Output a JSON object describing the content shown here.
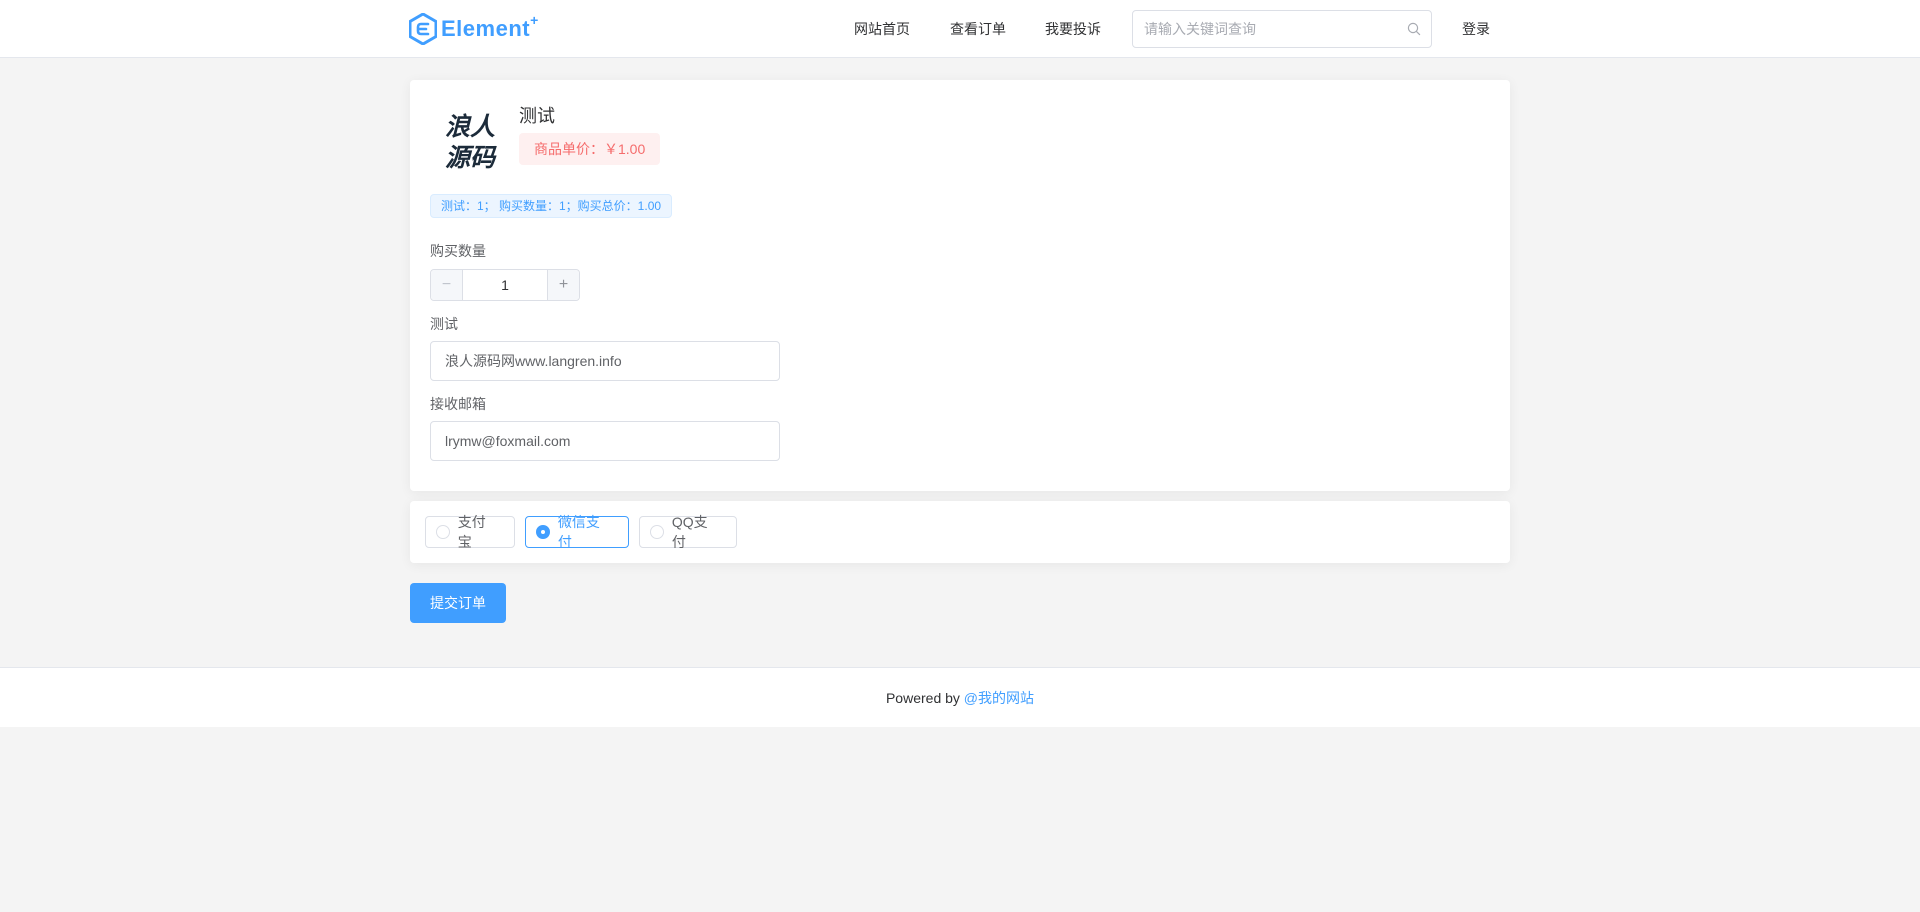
{
  "header": {
    "logo_text": "Element",
    "logo_sup": "+",
    "nav": [
      "网站首页",
      "查看订单",
      "我要投诉"
    ],
    "search_placeholder": "请输入关键词查询",
    "login_label": "登录"
  },
  "product": {
    "image_text_line1": "浪人",
    "image_text_line2": "源码",
    "title": "测试",
    "price_label": "商品单价：￥1.00",
    "summary": "测试：1； 购买数量：1；购买总价：1.00"
  },
  "form": {
    "quantity_label": "购买数量",
    "quantity_value": "1",
    "minus_symbol": "−",
    "plus_symbol": "+",
    "test_label": "测试",
    "test_value": "浪人源码网www.langren.info",
    "email_label": "接收邮箱",
    "email_value": "lrymw@foxmail.com"
  },
  "payment": {
    "options": [
      "支付宝",
      "微信支付",
      "QQ支付"
    ],
    "selected": "微信支付"
  },
  "submit_label": "提交订单",
  "footer": {
    "prefix": "Powered by ",
    "link": "@我的网站"
  },
  "colors": {
    "primary": "#409eff",
    "danger": "#f56c6c",
    "background": "#f4f4f4"
  }
}
